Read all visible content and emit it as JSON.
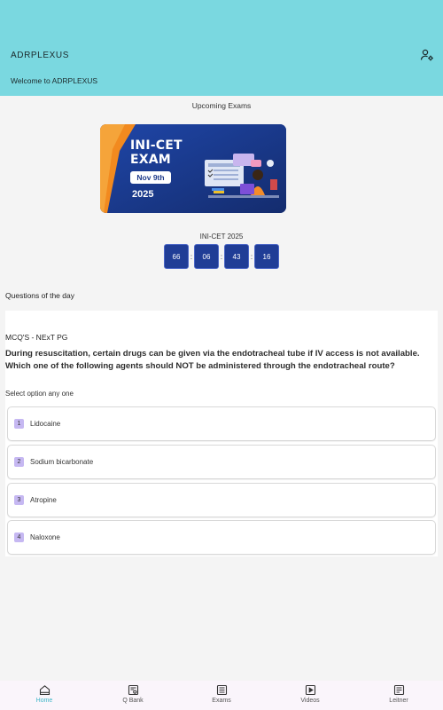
{
  "header": {
    "app_name": "ADRPLEXUS",
    "welcome": "Welcome to ADRPLEXUS"
  },
  "upcoming": {
    "title": "Upcoming Exams",
    "banner": {
      "line1": "INI-CET",
      "line2": "EXAM",
      "date": "Nov 9th",
      "year": "2025"
    }
  },
  "countdown": {
    "title": "INI-CET 2025",
    "values": [
      "66",
      "06",
      "43",
      "16"
    ],
    "separator": ":"
  },
  "qod": {
    "title": "Questions of the day",
    "category": "MCQ'S - NExT PG",
    "question": "During resuscitation, certain drugs can be given via the endotracheal tube if IV access is not available. Which one of the following agents should NOT be administered through the endotracheal route?",
    "instruction": "Select option any one",
    "options": [
      {
        "num": "1",
        "label": "Lidocaine"
      },
      {
        "num": "2",
        "label": "Sodium bicarbonate"
      },
      {
        "num": "3",
        "label": "Atropine"
      },
      {
        "num": "4",
        "label": "Naloxone"
      }
    ]
  },
  "nav": {
    "items": [
      {
        "label": "Home",
        "icon": "home-icon",
        "active": true
      },
      {
        "label": "Q Bank",
        "icon": "qbank-icon"
      },
      {
        "label": "Exams",
        "icon": "exams-icon"
      },
      {
        "label": "Videos",
        "icon": "videos-icon"
      },
      {
        "label": "Leitner",
        "icon": "leitner-icon"
      }
    ]
  },
  "colors": {
    "header_bg": "#7ad8e0",
    "countdown_bg": "#203d96",
    "option_badge": "#c6b8f2",
    "nav_active": "#3fb6c8"
  }
}
